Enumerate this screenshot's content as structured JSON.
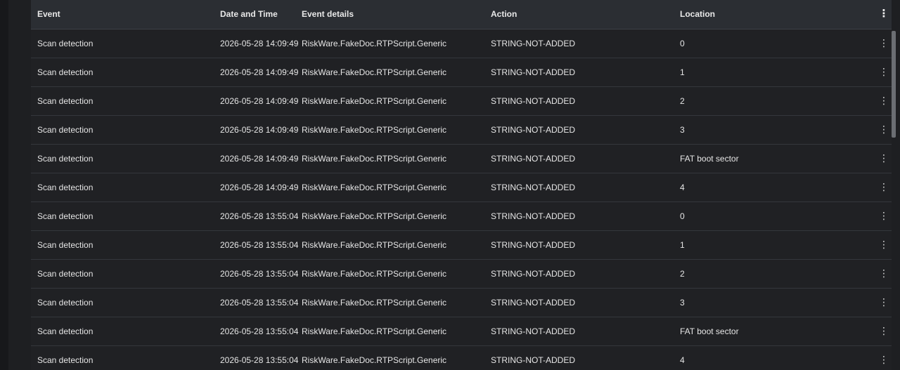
{
  "table": {
    "columns": [
      "Event",
      "Date and Time",
      "Event details",
      "Action",
      "Location"
    ],
    "header_menu_icon": "more-vertical-icon",
    "row_menu_icon": "more-vertical-icon",
    "rows": [
      {
        "event": "Scan detection",
        "datetime": "2026-05-28 14:09:49",
        "details": "RiskWare.FakeDoc.RTPScript.Generic",
        "action": "STRING-NOT-ADDED",
        "location": "0"
      },
      {
        "event": "Scan detection",
        "datetime": "2026-05-28 14:09:49",
        "details": "RiskWare.FakeDoc.RTPScript.Generic",
        "action": "STRING-NOT-ADDED",
        "location": "1"
      },
      {
        "event": "Scan detection",
        "datetime": "2026-05-28 14:09:49",
        "details": "RiskWare.FakeDoc.RTPScript.Generic",
        "action": "STRING-NOT-ADDED",
        "location": "2"
      },
      {
        "event": "Scan detection",
        "datetime": "2026-05-28 14:09:49",
        "details": "RiskWare.FakeDoc.RTPScript.Generic",
        "action": "STRING-NOT-ADDED",
        "location": "3"
      },
      {
        "event": "Scan detection",
        "datetime": "2026-05-28 14:09:49",
        "details": "RiskWare.FakeDoc.RTPScript.Generic",
        "action": "STRING-NOT-ADDED",
        "location": "FAT boot sector"
      },
      {
        "event": "Scan detection",
        "datetime": "2026-05-28 14:09:49",
        "details": "RiskWare.FakeDoc.RTPScript.Generic",
        "action": "STRING-NOT-ADDED",
        "location": "4"
      },
      {
        "event": "Scan detection",
        "datetime": "2026-05-28 13:55:04",
        "details": "RiskWare.FakeDoc.RTPScript.Generic",
        "action": "STRING-NOT-ADDED",
        "location": "0"
      },
      {
        "event": "Scan detection",
        "datetime": "2026-05-28 13:55:04",
        "details": "RiskWare.FakeDoc.RTPScript.Generic",
        "action": "STRING-NOT-ADDED",
        "location": "1"
      },
      {
        "event": "Scan detection",
        "datetime": "2026-05-28 13:55:04",
        "details": "RiskWare.FakeDoc.RTPScript.Generic",
        "action": "STRING-NOT-ADDED",
        "location": "2"
      },
      {
        "event": "Scan detection",
        "datetime": "2026-05-28 13:55:04",
        "details": "RiskWare.FakeDoc.RTPScript.Generic",
        "action": "STRING-NOT-ADDED",
        "location": "3"
      },
      {
        "event": "Scan detection",
        "datetime": "2026-05-28 13:55:04",
        "details": "RiskWare.FakeDoc.RTPScript.Generic",
        "action": "STRING-NOT-ADDED",
        "location": "FAT boot sector"
      },
      {
        "event": "Scan detection",
        "datetime": "2026-05-28 13:55:04",
        "details": "RiskWare.FakeDoc.RTPScript.Generic",
        "action": "STRING-NOT-ADDED",
        "location": "4"
      }
    ]
  },
  "colors": {
    "background": "#202124",
    "header_background": "#2b2e33",
    "row_divider": "#34373c",
    "text": "#e6e6e6"
  }
}
